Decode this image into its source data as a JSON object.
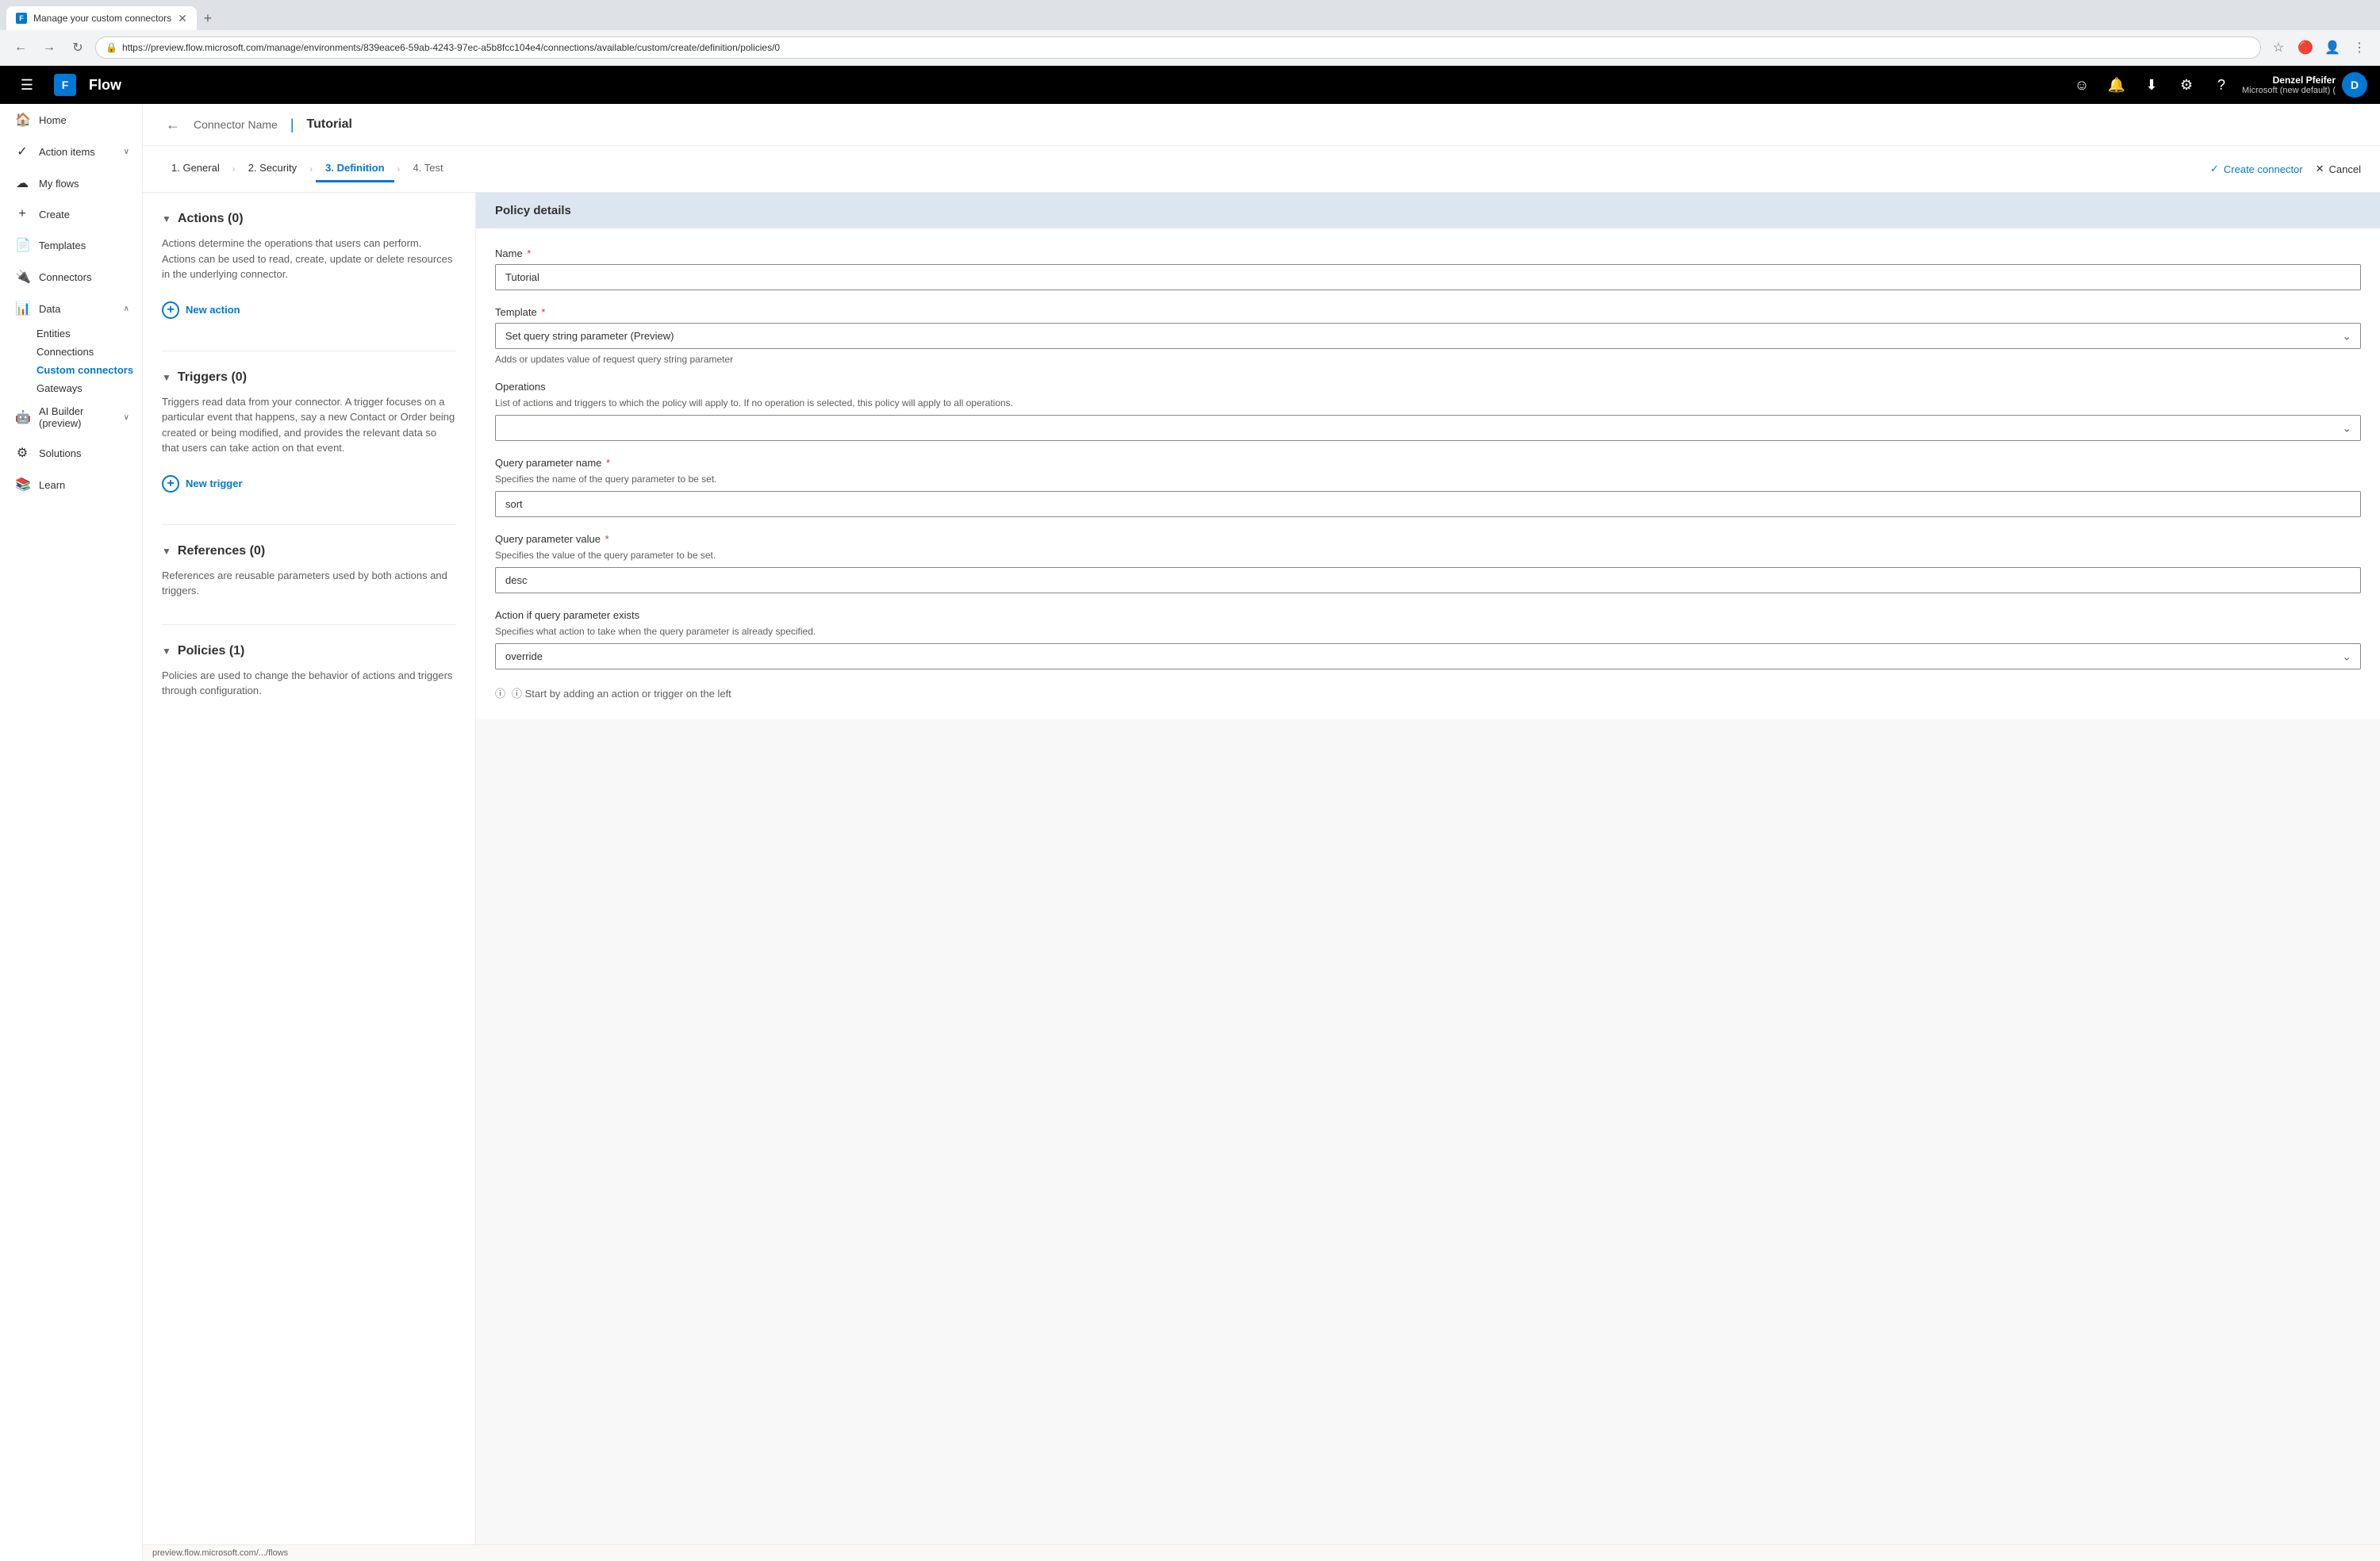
{
  "browser": {
    "tab_title": "Manage your custom connectors",
    "tab_favicon": "F",
    "url": "https://preview.flow.microsoft.com/manage/environments/839eace6-59ab-4243-97ec-a5b8fcc104e4/connections/available/custom/create/definition/policies/0",
    "new_tab_icon": "+",
    "back_icon": "←",
    "forward_icon": "→",
    "refresh_icon": "↻",
    "home_icon": "⌂",
    "star_icon": "☆",
    "extension_icon": "🔴",
    "menu_icon": "⋮",
    "status_bar": "preview.flow.microsoft.com/.../flows"
  },
  "header": {
    "grid_icon": "⊞",
    "title": "Flow",
    "icons": {
      "emoji": "☺",
      "bell": "🔔",
      "download": "⬇",
      "settings": "⚙",
      "help": "?"
    },
    "user": {
      "name": "Denzel Pfeifer",
      "tenant": "Microsoft (new default) (",
      "avatar_letter": "D"
    }
  },
  "sidebar": {
    "hamburger": "☰",
    "items": [
      {
        "id": "home",
        "label": "Home",
        "icon": "🏠",
        "has_chevron": false,
        "active": false
      },
      {
        "id": "action-items",
        "label": "Action items",
        "icon": "✓",
        "has_chevron": true,
        "active": false
      },
      {
        "id": "my-flows",
        "label": "My flows",
        "icon": "☁",
        "has_chevron": false,
        "active": false
      },
      {
        "id": "create",
        "label": "Create",
        "icon": "+",
        "has_chevron": false,
        "active": false
      },
      {
        "id": "templates",
        "label": "Templates",
        "icon": "📄",
        "has_chevron": false,
        "active": false
      },
      {
        "id": "connectors",
        "label": "Connectors",
        "icon": "🔌",
        "has_chevron": false,
        "active": false
      },
      {
        "id": "data",
        "label": "Data",
        "icon": "📊",
        "has_chevron": true,
        "active": false
      },
      {
        "id": "entities",
        "label": "Entities",
        "sub": true,
        "active": false
      },
      {
        "id": "connections",
        "label": "Connections",
        "sub": true,
        "active": false
      },
      {
        "id": "custom-connectors",
        "label": "Custom connectors",
        "sub": true,
        "active": true
      },
      {
        "id": "gateways",
        "label": "Gateways",
        "sub": true,
        "active": false
      },
      {
        "id": "ai-builder",
        "label": "AI Builder (preview)",
        "icon": "🤖",
        "has_chevron": true,
        "active": false
      },
      {
        "id": "solutions",
        "label": "Solutions",
        "icon": "⚙",
        "has_chevron": false,
        "active": false
      },
      {
        "id": "learn",
        "label": "Learn",
        "icon": "📚",
        "has_chevron": false,
        "active": false
      }
    ]
  },
  "page": {
    "back_label": "←",
    "breadcrumb_parent": "Connector Name",
    "breadcrumb_separator": "|",
    "breadcrumb_current": "Tutorial"
  },
  "wizard": {
    "steps": [
      {
        "id": "general",
        "label": "1. General",
        "active": false,
        "completed": true
      },
      {
        "id": "security",
        "label": "2. Security",
        "active": false,
        "completed": true
      },
      {
        "id": "definition",
        "label": "3. Definition",
        "active": true,
        "completed": false
      },
      {
        "id": "test",
        "label": "4. Test",
        "active": false,
        "completed": false
      }
    ],
    "create_btn": "Create connector",
    "cancel_btn": "Cancel",
    "check_icon": "✓",
    "x_icon": "✕"
  },
  "left_panel": {
    "sections": [
      {
        "id": "actions",
        "title": "Actions (0)",
        "collapsed": false,
        "description": "Actions determine the operations that users can perform. Actions can be used to read, create, update or delete resources in the underlying connector.",
        "new_btn_label": "New action"
      },
      {
        "id": "triggers",
        "title": "Triggers (0)",
        "collapsed": false,
        "description": "Triggers read data from your connector. A trigger focuses on a particular event that happens, say a new Contact or Order being created or being modified, and provides the relevant data so that users can take action on that event.",
        "new_btn_label": "New trigger"
      },
      {
        "id": "references",
        "title": "References (0)",
        "collapsed": false,
        "description": "References are reusable parameters used by both actions and triggers."
      },
      {
        "id": "policies",
        "title": "Policies (1)",
        "collapsed": false,
        "description": "Policies are used to change the behavior of actions and triggers through configuration."
      }
    ]
  },
  "right_panel": {
    "header": "Policy details",
    "fields": [
      {
        "id": "name",
        "label": "Name",
        "required": true,
        "type": "input",
        "value": "Tutorial"
      },
      {
        "id": "template",
        "label": "Template",
        "required": true,
        "type": "select",
        "value": "Set query string parameter (Preview)",
        "description": "Adds or updates value of request query string parameter",
        "options": [
          "Set query string parameter (Preview)"
        ]
      },
      {
        "id": "operations",
        "label": "Operations",
        "required": false,
        "type": "select",
        "value": "",
        "description_line1": "List of actions and triggers to which the policy will apply to. If no operation is selected, this policy will apply to all operations.",
        "options": []
      },
      {
        "id": "query_param_name",
        "label": "Query parameter name",
        "required": true,
        "type": "input",
        "value": "sort",
        "description": "Specifies the name of the query parameter to be set."
      },
      {
        "id": "query_param_value",
        "label": "Query parameter value",
        "required": true,
        "type": "input",
        "value": "desc",
        "description": "Specifies the value of the query parameter to be set."
      },
      {
        "id": "action_if_exists",
        "label": "Action if query parameter exists",
        "required": false,
        "type": "select",
        "value": "override",
        "description": "Specifies what action to take when the query parameter is already specified.",
        "options": [
          "override"
        ]
      }
    ],
    "bottom_hint": "ⓘ Start by adding an action or trigger on the left"
  }
}
